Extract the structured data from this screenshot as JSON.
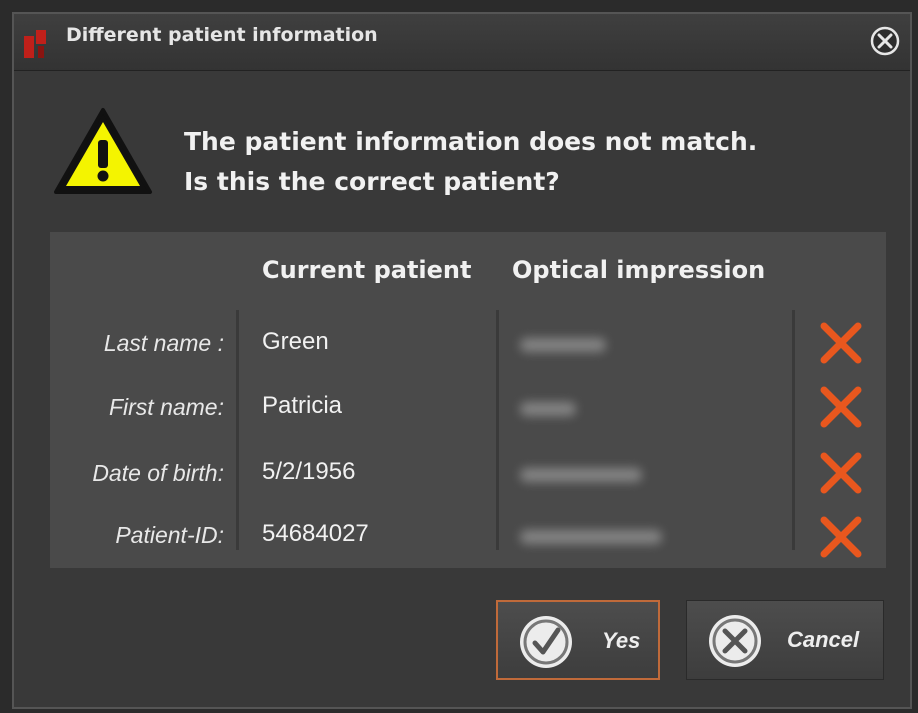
{
  "window": {
    "title": "Different patient information"
  },
  "message": {
    "line1": "The patient information does not match.",
    "line2": "Is this the correct patient?"
  },
  "table": {
    "headers": {
      "current": "Current patient",
      "optical": "Optical impression"
    },
    "rows": [
      {
        "label": "Last name :",
        "current": "Green",
        "mismatch": true
      },
      {
        "label": "First name:",
        "current": "Patricia",
        "mismatch": true
      },
      {
        "label": "Date of birth:",
        "current": "5/2/1956",
        "mismatch": true
      },
      {
        "label": "Patient-ID:",
        "current": "54684027",
        "mismatch": true
      }
    ]
  },
  "buttons": {
    "yes": "Yes",
    "cancel": "Cancel"
  },
  "colors": {
    "warning_yellow": "#f4f400",
    "mismatch_orange": "#e8571e",
    "yes_border": "#c06a3a"
  },
  "icons": {
    "app": "app-logo-icon",
    "close": "close-circle-icon",
    "warning": "warning-triangle-icon",
    "mismatch": "x-mark-icon",
    "yes": "check-circle-icon",
    "cancel": "cancel-circle-icon"
  }
}
